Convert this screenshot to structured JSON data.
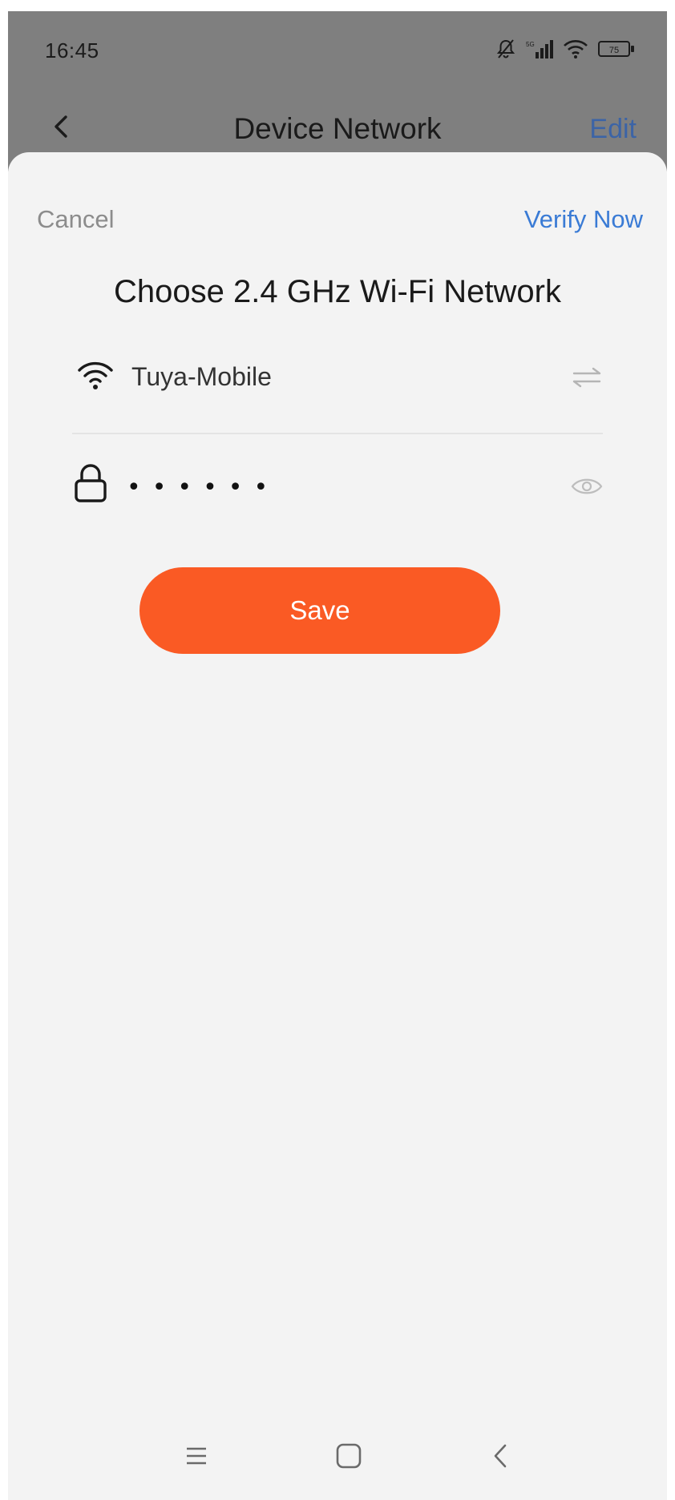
{
  "status_bar": {
    "time": "16:45",
    "battery_level": "75",
    "icons": [
      "bell-off-icon",
      "signal-icon",
      "wifi-icon",
      "battery-icon"
    ]
  },
  "nav_bar": {
    "back_icon": "chevron-left-icon",
    "title": "Device Network",
    "edit_label": "Edit"
  },
  "sheet": {
    "cancel_label": "Cancel",
    "verify_label": "Verify Now",
    "title": "Choose 2.4 GHz Wi-Fi Network",
    "ssid": {
      "icon": "wifi-icon",
      "name": "Tuya-Mobile",
      "switch_icon": "swap-icon"
    },
    "password": {
      "icon": "lock-icon",
      "value": "••••••",
      "toggle_icon": "eye-icon"
    },
    "save_label": "Save"
  },
  "android_nav": {
    "icons": [
      "menu-icon",
      "home-icon",
      "back-icon"
    ]
  },
  "colors": {
    "accent": "#fa5a24",
    "link": "#3a7bd5",
    "edit_link": "#3c64a6",
    "sheet_bg": "#f3f3f3",
    "dim_overlay": "#7f7f7f"
  }
}
